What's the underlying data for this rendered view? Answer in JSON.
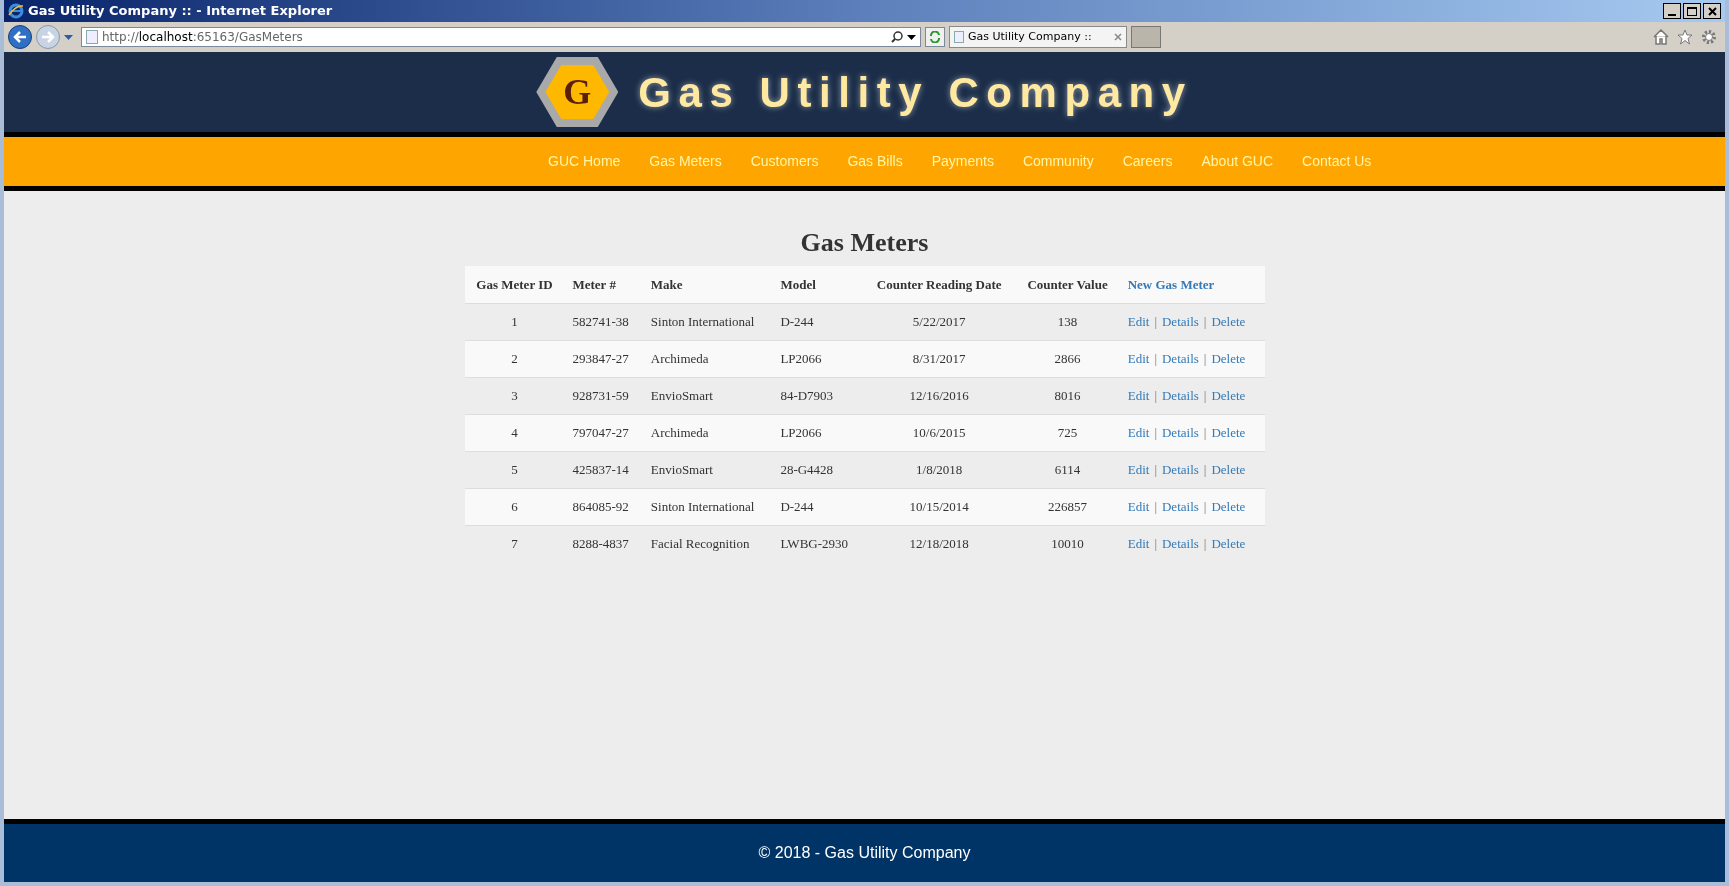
{
  "window": {
    "title": "Gas Utility Company :: - Internet Explorer"
  },
  "address_bar": {
    "prefix": "http://",
    "host": "localhost",
    "rest": ":65163/GasMeters"
  },
  "tabs": [
    {
      "label": "Gas Utility Company ::",
      "selected": true
    }
  ],
  "site": {
    "logo_letter": "G",
    "name": "Gas Utility Company"
  },
  "nav": [
    "GUC Home",
    "Gas Meters",
    "Customers",
    "Gas Bills",
    "Payments",
    "Community",
    "Careers",
    "About GUC",
    "Contact Us"
  ],
  "page_title": "Gas Meters",
  "table": {
    "columns": [
      "Gas Meter ID",
      "Meter #",
      "Make",
      "Model",
      "Counter Reading Date",
      "Counter Value"
    ],
    "new_link": "New Gas Meter",
    "action_separator": "|",
    "rows": [
      {
        "cells": [
          "1",
          "582741-38",
          "Sinton International",
          "D-244",
          "5/22/2017",
          "138"
        ],
        "actions": [
          "Edit",
          "Details",
          "Delete"
        ]
      },
      {
        "cells": [
          "2",
          "293847-27",
          "Archimeda",
          "LP2066",
          "8/31/2017",
          "2866"
        ],
        "actions": [
          "Edit",
          "Details",
          "Delete"
        ]
      },
      {
        "cells": [
          "3",
          "928731-59",
          "EnvioSmart",
          "84-D7903",
          "12/16/2016",
          "8016"
        ],
        "actions": [
          "Edit",
          "Details",
          "Delete"
        ]
      },
      {
        "cells": [
          "4",
          "797047-27",
          "Archimeda",
          "LP2066",
          "10/6/2015",
          "725"
        ],
        "actions": [
          "Edit",
          "Details",
          "Delete"
        ]
      },
      {
        "cells": [
          "5",
          "425837-14",
          "EnvioSmart",
          "28-G4428",
          "1/8/2018",
          "6114"
        ],
        "actions": [
          "Edit",
          "Details",
          "Delete"
        ]
      },
      {
        "cells": [
          "6",
          "864085-92",
          "Sinton International",
          "D-244",
          "10/15/2014",
          "226857"
        ],
        "actions": [
          "Edit",
          "Details",
          "Delete"
        ]
      },
      {
        "cells": [
          "7",
          "8288-4837",
          "Facial Recognition",
          "LWBG-2930",
          "12/18/2018",
          "10010"
        ],
        "actions": [
          "Edit",
          "Details",
          "Delete"
        ]
      }
    ]
  },
  "footer": "© 2018 - Gas Utility Company"
}
